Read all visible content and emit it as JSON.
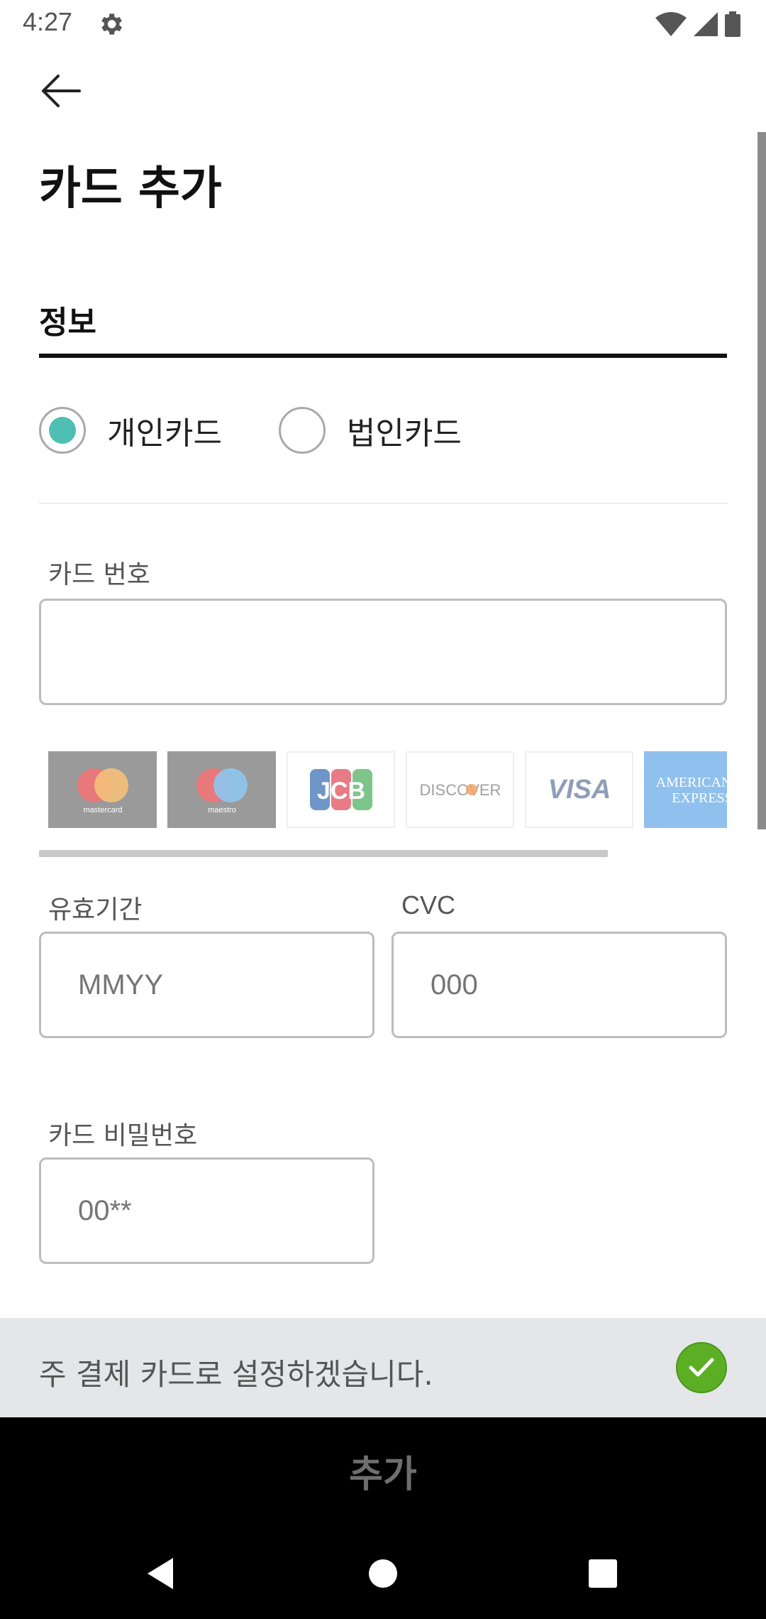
{
  "status_bar": {
    "time": "4:27"
  },
  "header": {
    "title": "카드 추가"
  },
  "info_section": {
    "title": "정보"
  },
  "card_type": {
    "options": [
      {
        "label": "개인카드",
        "selected": true
      },
      {
        "label": "법인카드",
        "selected": false
      }
    ],
    "accent_color": "#4fbfb3"
  },
  "card_number": {
    "label": "카드 번호",
    "value": "",
    "placeholder": ""
  },
  "card_brands": {
    "mastercard": "mastercard",
    "maestro": "maestro",
    "jcb": "JCB",
    "discover": "DISCOVER",
    "visa": "VISA",
    "amex_line1": "AMERICAN",
    "amex_line2": "EXPRESS"
  },
  "expiry": {
    "label": "유효기간",
    "placeholder": "MMYY"
  },
  "cvc": {
    "label": "CVC",
    "placeholder": "000"
  },
  "card_password": {
    "label": "카드 비밀번호",
    "placeholder": "00**"
  },
  "primary_card": {
    "text": "주 결제 카드로 설정하겠습니다.",
    "checked": true,
    "check_color": "#5cae24"
  },
  "submit": {
    "label": "추가"
  }
}
